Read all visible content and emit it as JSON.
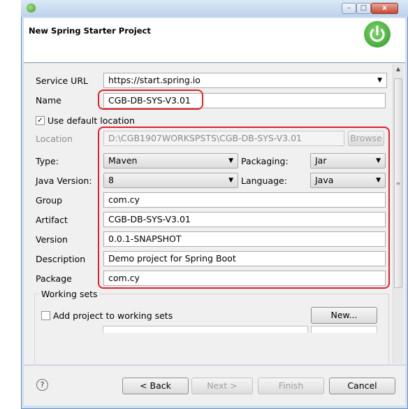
{
  "window": {
    "title": "",
    "controls": {
      "minimize": "–",
      "maximize": "□",
      "close": "x"
    },
    "icon": "spring-leaf-icon"
  },
  "header": {
    "title": "New Spring Starter Project",
    "logo_icon": "spring-power-icon"
  },
  "form": {
    "service_url_label": "Service URL",
    "service_url_value": "https://start.spring.io",
    "name_label": "Name",
    "name_value": "CGB-DB-SYS-V3.01",
    "use_default_location_label": "Use default location",
    "use_default_location_checked": true,
    "location_label": "Location",
    "location_value": "D:\\CGB1907WORKSPSTS\\CGB-DB-SYS-V3.01",
    "browse_label": "Browse",
    "type_label": "Type:",
    "type_value": "Maven",
    "packaging_label": "Packaging:",
    "packaging_value": "Jar",
    "java_version_label": "Java Version:",
    "java_version_value": "8",
    "language_label": "Language:",
    "language_value": "Java",
    "group_label": "Group",
    "group_value": "com.cy",
    "artifact_label": "Artifact",
    "artifact_value": "CGB-DB-SYS-V3.01",
    "version_label": "Version",
    "version_value": "0.0.1-SNAPSHOT",
    "description_label": "Description",
    "description_value": "Demo project for Spring Boot",
    "package_label": "Package",
    "package_value": "com.cy"
  },
  "working_sets": {
    "title": "Working sets",
    "add_label": "Add project to working sets",
    "new_button": "New..."
  },
  "footer": {
    "help_icon": "help-icon",
    "back_button": "< Back",
    "next_button": "Next >",
    "finish_button": "Finish",
    "cancel_button": "Cancel"
  },
  "colors": {
    "highlight": "#e0222a",
    "spring_green": "#2f9a2b",
    "title_bar": "#cfe0f3"
  }
}
